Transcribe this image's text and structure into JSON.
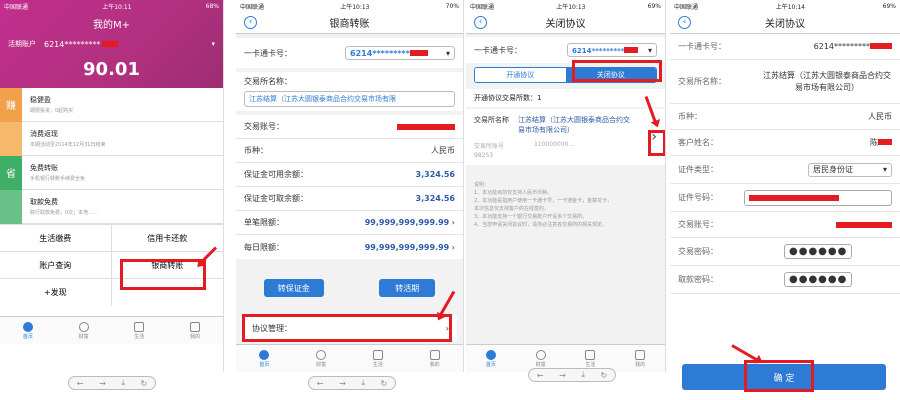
{
  "colors": {
    "accent": "#2e7bd6",
    "highlight": "#e31b23",
    "banner": "#c12f8d"
  },
  "phone1": {
    "status": {
      "carrier": "中国联通",
      "time": "上午10:11",
      "battery": "68%"
    },
    "title": "我的M+",
    "account_label": "活期账户",
    "card_no": "6214*********",
    "balance": "90.01",
    "promos": [
      {
        "badge": "赚",
        "title": "稳健盈",
        "desc": "期限投资，0起购买"
      },
      {
        "badge": "",
        "title": "消费返现",
        "desc": "本期活动至2014年12月31日结束"
      },
      {
        "badge": "省",
        "title": "免费转账",
        "desc": "手机银行转账手续费全免"
      },
      {
        "badge": "",
        "title": "取款免费",
        "desc": "跨行取款免费，0次；本地……"
      }
    ],
    "grid": [
      {
        "label": "生活缴费"
      },
      {
        "label": "信用卡还款"
      },
      {
        "label": "账户查询"
      },
      {
        "label": "银商转账"
      },
      {
        "label": "+发现"
      },
      {
        "label": ""
      }
    ],
    "tabs": [
      {
        "label": "首页"
      },
      {
        "label": "财富"
      },
      {
        "label": "生活"
      },
      {
        "label": "我的"
      }
    ],
    "toolbar": [
      "←",
      "→",
      "⤓",
      "↻"
    ]
  },
  "phone2": {
    "status": {
      "carrier": "中国联通",
      "time": "上午10:13",
      "battery": "70%"
    },
    "title": "银商转账",
    "card_label": "一卡通卡号：",
    "card_no": "6214*********",
    "exchange_label": "交易所名称：",
    "exchange_value": "江苏结算（江苏大圆银泰商品合约交易市场有限",
    "trade_acct_label": "交易账号：",
    "currency_label": "币种：",
    "currency_value": "人民币",
    "avail_label": "保证金可用余额：",
    "avail_value": "3,324.56",
    "withdraw_label": "保证金可取余额：",
    "withdraw_value": "3,324.56",
    "single_label": "单笔限额：",
    "single_value": "99,999,999,999.99",
    "daily_label": "每日限额：",
    "daily_value": "99,999,999,999.99",
    "btn_to_margin": "转保证金",
    "btn_to_card": "转活期",
    "agreement_label": "协议管理：",
    "tabs": [
      {
        "label": "首页"
      },
      {
        "label": "财富"
      },
      {
        "label": "生活"
      },
      {
        "label": "我的"
      }
    ],
    "toolbar": [
      "←",
      "→",
      "⤓",
      "↻"
    ]
  },
  "phone3": {
    "status": {
      "carrier": "中国联通",
      "time": "上午10:13",
      "battery": "69%"
    },
    "title": "关闭协议",
    "card_label": "一卡通卡号：",
    "card_no": "6214*********",
    "seg_open": "开通协议",
    "seg_close": "关闭协议",
    "count_label": "开通协议交易所数：1",
    "exchange_label": "交易所名称",
    "exchange_value": "江苏结算（江苏大圆银泰商品合约交易市场有限公司）",
    "acct_label": "交易所账号",
    "acct_value": "110000000…",
    "acct_prefix": "98253",
    "notes_title": "说明：",
    "notes": [
      "1、本功能目前仅支持人民币币种。",
      "2、本功能是指用户使用一卡通卡号，一卡通金卡，金葵花卡，",
      "   本次信息仅支持客户的在线签约。",
      "3、本功能支持一个银行交易账户开设多个交易所。",
      "4、当您申请关闭协议时，请务必注意各交易所的相关规定。"
    ],
    "tabs": [
      {
        "label": "首页"
      },
      {
        "label": "财富"
      },
      {
        "label": "生活"
      },
      {
        "label": "我的"
      }
    ],
    "toolbar": [
      "←",
      "→",
      "⤓",
      "↻"
    ]
  },
  "phone4": {
    "status": {
      "carrier": "中国联通",
      "time": "上午10:14",
      "battery": "69%"
    },
    "title": "关闭协议",
    "card_label": "一卡通卡号：",
    "card_no": "6214*********",
    "exchange_label": "交易所名称：",
    "exchange_value": "江苏结算（江苏大圆银泰商品合约交易市场有限公司）",
    "currency_label": "币种：",
    "currency_value": "人民币",
    "name_label": "客户姓名：",
    "name_value": "陈",
    "idtype_label": "证件类型：",
    "idtype_value": "居民身份证",
    "idno_label": "证件号码：",
    "trade_acct_label": "交易账号：",
    "trade_pwd_label": "交易密码：",
    "trade_pwd_value": "●●●●●●",
    "draw_pwd_label": "取款密码：",
    "draw_pwd_value": "●●●●●●",
    "confirm": "确 定"
  }
}
